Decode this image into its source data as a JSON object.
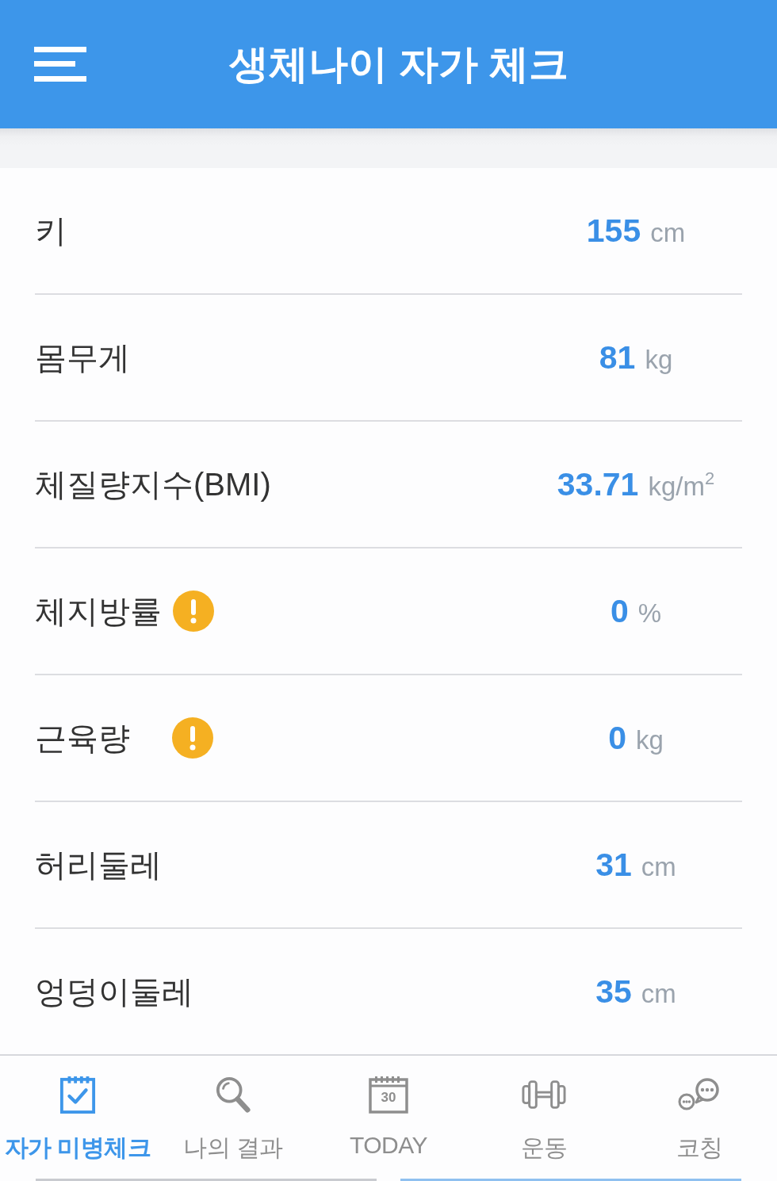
{
  "header": {
    "title": "생체나이 자가 체크"
  },
  "measurements": [
    {
      "label": "키",
      "value": "155",
      "unit": "cm",
      "warning": false
    },
    {
      "label": "몸무게",
      "value": "81",
      "unit": "kg",
      "warning": false
    },
    {
      "label": "체질량지수(BMI)",
      "value": "33.71",
      "unit": "kg/m$^{2}$",
      "warning": false
    },
    {
      "label": "체지방률",
      "value": "0",
      "unit": "%",
      "warning": true
    },
    {
      "label": "근육량",
      "value": "0",
      "unit": "kg",
      "warning": true
    },
    {
      "label": "허리둘레",
      "value": "31",
      "unit": "cm",
      "warning": false
    },
    {
      "label": "엉덩이둘레",
      "value": "35",
      "unit": "cm",
      "warning": false
    }
  ],
  "tabs": [
    {
      "label": "자가 미병체크",
      "selected": true
    },
    {
      "label": "나의 결과",
      "selected": false
    },
    {
      "label": "TODAY",
      "selected": false,
      "icon_text": "30"
    },
    {
      "label": "운동",
      "selected": false
    },
    {
      "label": "코칭",
      "selected": false
    }
  ]
}
